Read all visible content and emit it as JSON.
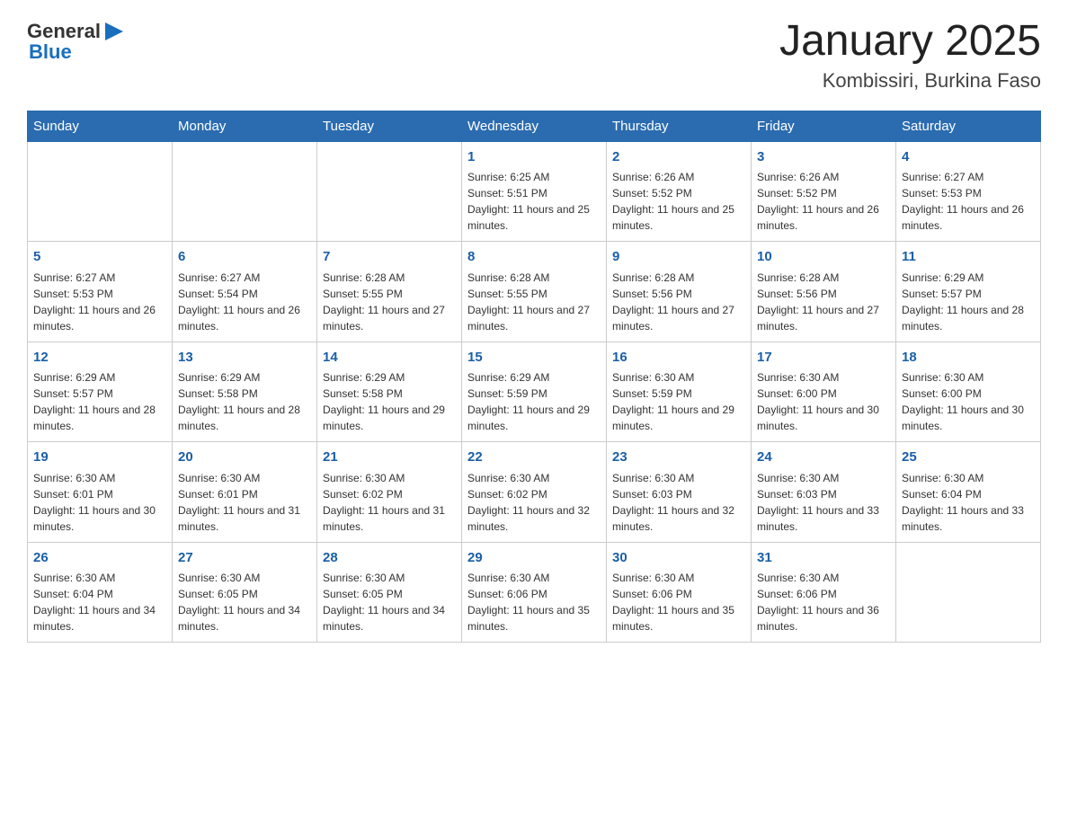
{
  "header": {
    "logo_general": "General",
    "logo_blue": "Blue",
    "month_year": "January 2025",
    "location": "Kombissiri, Burkina Faso"
  },
  "calendar": {
    "weekdays": [
      "Sunday",
      "Monday",
      "Tuesday",
      "Wednesday",
      "Thursday",
      "Friday",
      "Saturday"
    ],
    "weeks": [
      [
        {
          "day": "",
          "info": ""
        },
        {
          "day": "",
          "info": ""
        },
        {
          "day": "",
          "info": ""
        },
        {
          "day": "1",
          "info": "Sunrise: 6:25 AM\nSunset: 5:51 PM\nDaylight: 11 hours and 25 minutes."
        },
        {
          "day": "2",
          "info": "Sunrise: 6:26 AM\nSunset: 5:52 PM\nDaylight: 11 hours and 25 minutes."
        },
        {
          "day": "3",
          "info": "Sunrise: 6:26 AM\nSunset: 5:52 PM\nDaylight: 11 hours and 26 minutes."
        },
        {
          "day": "4",
          "info": "Sunrise: 6:27 AM\nSunset: 5:53 PM\nDaylight: 11 hours and 26 minutes."
        }
      ],
      [
        {
          "day": "5",
          "info": "Sunrise: 6:27 AM\nSunset: 5:53 PM\nDaylight: 11 hours and 26 minutes."
        },
        {
          "day": "6",
          "info": "Sunrise: 6:27 AM\nSunset: 5:54 PM\nDaylight: 11 hours and 26 minutes."
        },
        {
          "day": "7",
          "info": "Sunrise: 6:28 AM\nSunset: 5:55 PM\nDaylight: 11 hours and 27 minutes."
        },
        {
          "day": "8",
          "info": "Sunrise: 6:28 AM\nSunset: 5:55 PM\nDaylight: 11 hours and 27 minutes."
        },
        {
          "day": "9",
          "info": "Sunrise: 6:28 AM\nSunset: 5:56 PM\nDaylight: 11 hours and 27 minutes."
        },
        {
          "day": "10",
          "info": "Sunrise: 6:28 AM\nSunset: 5:56 PM\nDaylight: 11 hours and 27 minutes."
        },
        {
          "day": "11",
          "info": "Sunrise: 6:29 AM\nSunset: 5:57 PM\nDaylight: 11 hours and 28 minutes."
        }
      ],
      [
        {
          "day": "12",
          "info": "Sunrise: 6:29 AM\nSunset: 5:57 PM\nDaylight: 11 hours and 28 minutes."
        },
        {
          "day": "13",
          "info": "Sunrise: 6:29 AM\nSunset: 5:58 PM\nDaylight: 11 hours and 28 minutes."
        },
        {
          "day": "14",
          "info": "Sunrise: 6:29 AM\nSunset: 5:58 PM\nDaylight: 11 hours and 29 minutes."
        },
        {
          "day": "15",
          "info": "Sunrise: 6:29 AM\nSunset: 5:59 PM\nDaylight: 11 hours and 29 minutes."
        },
        {
          "day": "16",
          "info": "Sunrise: 6:30 AM\nSunset: 5:59 PM\nDaylight: 11 hours and 29 minutes."
        },
        {
          "day": "17",
          "info": "Sunrise: 6:30 AM\nSunset: 6:00 PM\nDaylight: 11 hours and 30 minutes."
        },
        {
          "day": "18",
          "info": "Sunrise: 6:30 AM\nSunset: 6:00 PM\nDaylight: 11 hours and 30 minutes."
        }
      ],
      [
        {
          "day": "19",
          "info": "Sunrise: 6:30 AM\nSunset: 6:01 PM\nDaylight: 11 hours and 30 minutes."
        },
        {
          "day": "20",
          "info": "Sunrise: 6:30 AM\nSunset: 6:01 PM\nDaylight: 11 hours and 31 minutes."
        },
        {
          "day": "21",
          "info": "Sunrise: 6:30 AM\nSunset: 6:02 PM\nDaylight: 11 hours and 31 minutes."
        },
        {
          "day": "22",
          "info": "Sunrise: 6:30 AM\nSunset: 6:02 PM\nDaylight: 11 hours and 32 minutes."
        },
        {
          "day": "23",
          "info": "Sunrise: 6:30 AM\nSunset: 6:03 PM\nDaylight: 11 hours and 32 minutes."
        },
        {
          "day": "24",
          "info": "Sunrise: 6:30 AM\nSunset: 6:03 PM\nDaylight: 11 hours and 33 minutes."
        },
        {
          "day": "25",
          "info": "Sunrise: 6:30 AM\nSunset: 6:04 PM\nDaylight: 11 hours and 33 minutes."
        }
      ],
      [
        {
          "day": "26",
          "info": "Sunrise: 6:30 AM\nSunset: 6:04 PM\nDaylight: 11 hours and 34 minutes."
        },
        {
          "day": "27",
          "info": "Sunrise: 6:30 AM\nSunset: 6:05 PM\nDaylight: 11 hours and 34 minutes."
        },
        {
          "day": "28",
          "info": "Sunrise: 6:30 AM\nSunset: 6:05 PM\nDaylight: 11 hours and 34 minutes."
        },
        {
          "day": "29",
          "info": "Sunrise: 6:30 AM\nSunset: 6:06 PM\nDaylight: 11 hours and 35 minutes."
        },
        {
          "day": "30",
          "info": "Sunrise: 6:30 AM\nSunset: 6:06 PM\nDaylight: 11 hours and 35 minutes."
        },
        {
          "day": "31",
          "info": "Sunrise: 6:30 AM\nSunset: 6:06 PM\nDaylight: 11 hours and 36 minutes."
        },
        {
          "day": "",
          "info": ""
        }
      ]
    ]
  }
}
